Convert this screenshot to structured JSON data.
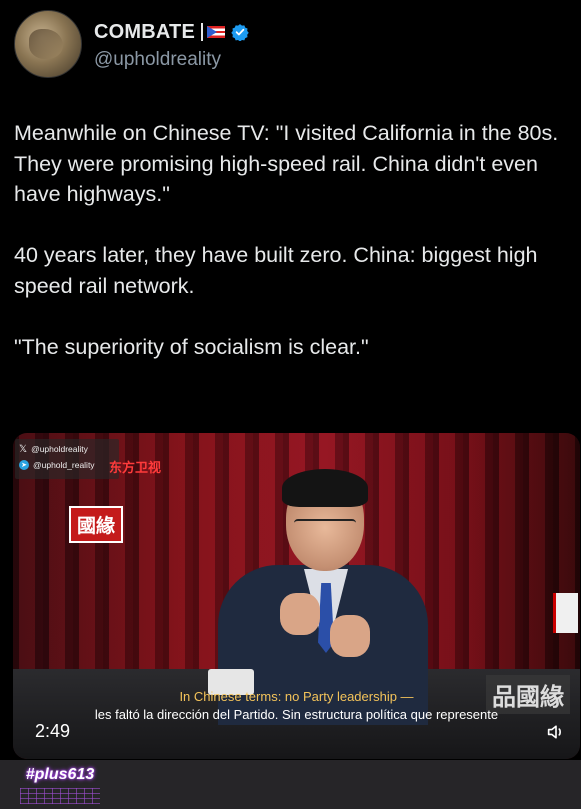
{
  "author": {
    "display_name": "COMBATE",
    "handle": "@upholdreality",
    "flag": "puerto-rico-flag",
    "verified": "verified-badge-icon"
  },
  "tweet": {
    "paragraphs": [
      "Meanwhile on Chinese TV: \"I visited California in the 80s. They were promising high-speed rail. China didn't even have highways.\"",
      "40 years later, they have built zero. China: biggest high speed rail network.",
      "\"The superiority of socialism is clear.\""
    ]
  },
  "video": {
    "watermark": {
      "x_handle": "@upholdreality",
      "telegram_handle": "@uphold_reality"
    },
    "channel_logo": "东方卫视",
    "show_tag": "國緣",
    "right_sign": "品國緣",
    "subtitle_en": "In Chinese terms: no Party leadership —",
    "subtitle_es": "les faltó la dirección del Partido. Sin estructura política que represente",
    "duration": "2:49",
    "volume_icon": "speaker-icon"
  },
  "footer": {
    "brand": "#plus613"
  },
  "colors": {
    "background": "#000000",
    "text": "#e7e9ea",
    "handle": "#8b98a5",
    "verified": "#1d9bf0",
    "subtitle_en": "#f3c35a"
  }
}
